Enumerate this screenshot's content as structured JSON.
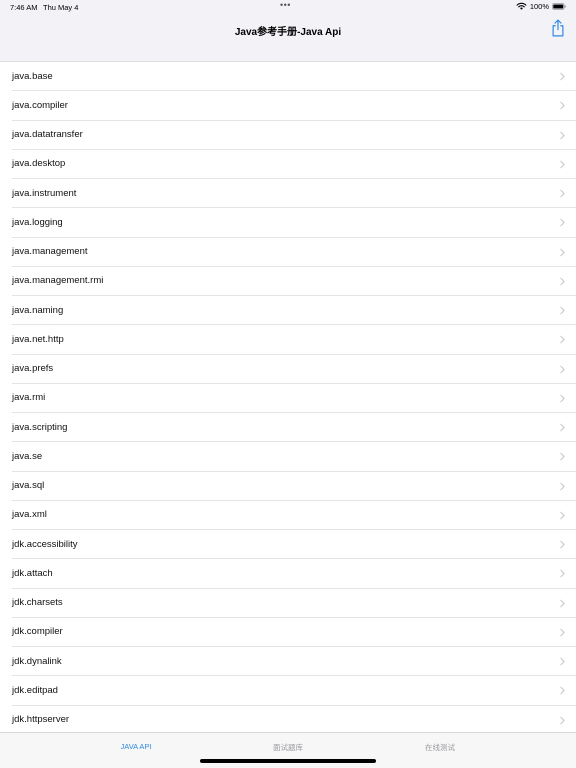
{
  "status": {
    "time": "7:46 AM",
    "date": "Thu May 4",
    "dots": "•••",
    "battery": "100%"
  },
  "nav": {
    "title": "Java参考手册-Java Api",
    "share_icon": "share-icon"
  },
  "list": {
    "items": [
      {
        "label": "java.base"
      },
      {
        "label": "java.compiler"
      },
      {
        "label": "java.datatransfer"
      },
      {
        "label": "java.desktop"
      },
      {
        "label": "java.instrument"
      },
      {
        "label": "java.logging"
      },
      {
        "label": "java.management"
      },
      {
        "label": "java.management.rmi"
      },
      {
        "label": "java.naming"
      },
      {
        "label": "java.net.http"
      },
      {
        "label": "java.prefs"
      },
      {
        "label": "java.rmi"
      },
      {
        "label": "java.scripting"
      },
      {
        "label": "java.se"
      },
      {
        "label": "java.sql"
      },
      {
        "label": "java.xml"
      },
      {
        "label": "jdk.accessibility"
      },
      {
        "label": "jdk.attach"
      },
      {
        "label": "jdk.charsets"
      },
      {
        "label": "jdk.compiler"
      },
      {
        "label": "jdk.dynalink"
      },
      {
        "label": "jdk.editpad"
      },
      {
        "label": "jdk.httpserver"
      }
    ]
  },
  "tabs": [
    {
      "label": "JAVA API",
      "active": true
    },
    {
      "label": "面试题库",
      "active": false
    },
    {
      "label": "在线测试",
      "active": false
    }
  ],
  "colors": {
    "accent": "#2f8ae3",
    "inactive_tab": "#9a9a9f",
    "bar_background": "#f2f2f7"
  }
}
